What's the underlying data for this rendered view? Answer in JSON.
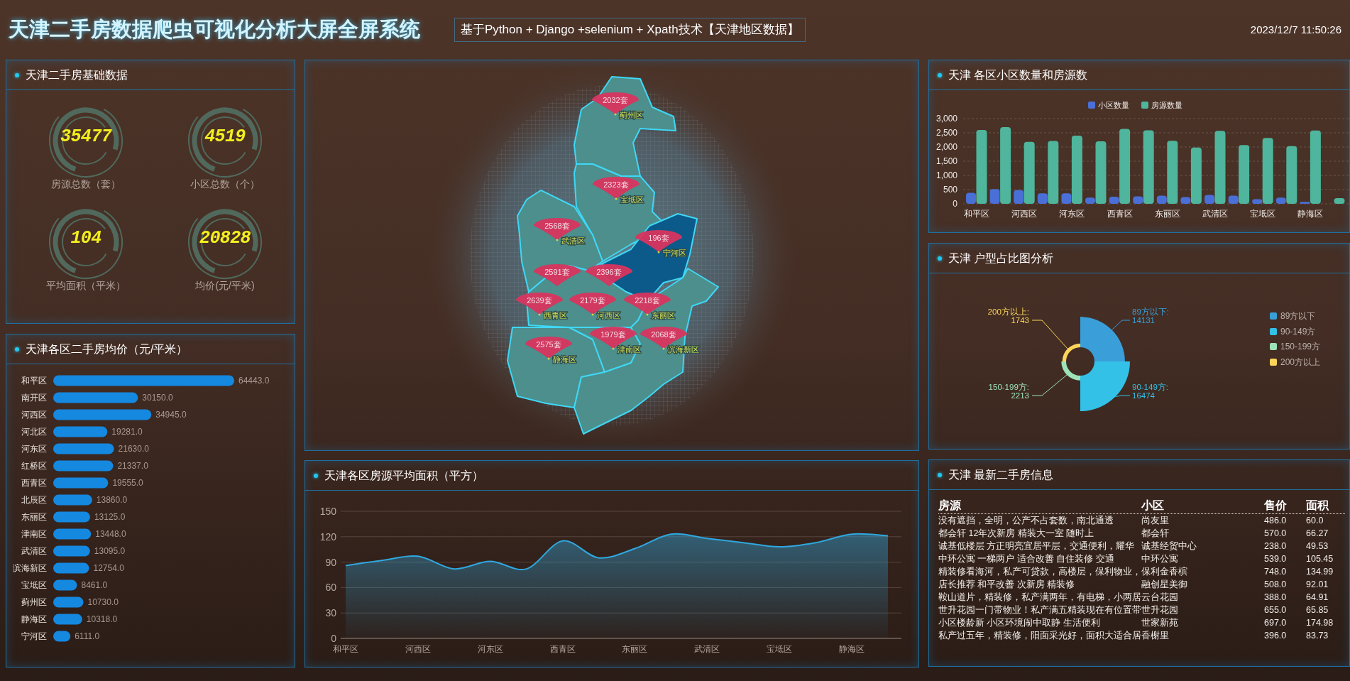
{
  "header": {
    "title": "天津二手房数据爬虫可视化分析大屏全屏系统",
    "subtitle": "基于Python + Django +selenium + Xpath技术【天津地区数据】",
    "datetime": "2023/12/7 11:50:26"
  },
  "overview": {
    "title": "天津二手房基础数据",
    "stats": [
      {
        "value": "35477",
        "label": "房源总数（套）"
      },
      {
        "value": "4519",
        "label": "小区总数（个）"
      },
      {
        "value": "104",
        "label": "平均面积（平米）"
      },
      {
        "value": "20828",
        "label": "均价(元/平米)"
      }
    ]
  },
  "district_price": {
    "title": "天津各区二手房均价（元/平米）",
    "chart_data": {
      "type": "bar",
      "orientation": "horizontal",
      "categories": [
        "和平区",
        "南开区",
        "河西区",
        "河北区",
        "河东区",
        "红桥区",
        "西青区",
        "北辰区",
        "东丽区",
        "津南区",
        "武清区",
        "滨海新区",
        "宝坻区",
        "蓟州区",
        "静海区",
        "宁河区"
      ],
      "values": [
        64443,
        30150,
        34945,
        19281,
        21630,
        21337,
        19555,
        13860,
        13125,
        13448,
        13095,
        12754,
        8461,
        10730,
        10318,
        6111
      ],
      "value_labels": [
        "64443.0",
        "30150.0",
        "34945.0",
        "19281.0",
        "21630.0",
        "21337.0",
        "19555.0",
        "13860.0",
        "13125.0",
        "13448.0",
        "13095.0",
        "12754.0",
        "8461.0",
        "10730.0",
        "10318.0",
        "6111.0"
      ]
    }
  },
  "map": {
    "markers": [
      {
        "count": "2032套",
        "district": "蓟州区",
        "selected": false
      },
      {
        "count": "2323套",
        "district": "宝坻区",
        "selected": false
      },
      {
        "count": "2568套",
        "district": "武清区",
        "selected": false
      },
      {
        "count": "196套",
        "district": "宁河区",
        "selected": true
      },
      {
        "count": "2591套",
        "selected": false
      },
      {
        "count": "2396套",
        "selected": false
      },
      {
        "count": "2639套",
        "district": "西青区",
        "selected": false
      },
      {
        "count": "2179套",
        "district": "河西区",
        "selected": false
      },
      {
        "count": "2218套",
        "district": "东丽区",
        "selected": false
      },
      {
        "count": "1979套",
        "district": "津南区",
        "selected": false
      },
      {
        "count": "2068套",
        "district": "滨海新区",
        "selected": false
      },
      {
        "count": "2575套",
        "district": "静海区",
        "selected": false
      }
    ]
  },
  "area_trend": {
    "title": "天津各区房源平均面积（平方）",
    "chart_data": {
      "type": "area",
      "categories": [
        "和平区",
        null,
        "河西区",
        null,
        "河东区",
        null,
        "西青区",
        null,
        "东丽区",
        null,
        "武清区",
        null,
        "宝坻区",
        null,
        "静海区",
        null
      ],
      "yticks": [
        0,
        30,
        60,
        90,
        120,
        150
      ],
      "ylim": [
        0,
        150
      ],
      "grid": true,
      "series": [
        {
          "color": "#2fa8e0",
          "values": [
            86,
            92,
            97,
            82,
            91,
            82,
            115,
            95,
            106,
            123,
            118,
            113,
            108,
            113,
            123,
            121
          ]
        }
      ]
    }
  },
  "community_counts": {
    "title": "天津 各区小区数量和房源数",
    "chart_data": {
      "type": "bar",
      "categories": [
        "和平区",
        null,
        "河西区",
        null,
        "河东区",
        null,
        "西青区",
        null,
        "东丽区",
        null,
        "武清区",
        null,
        "宝坻区",
        null,
        "静海区",
        null
      ],
      "yticks": [
        {
          "value": 0,
          "label": "0"
        },
        {
          "value": 500,
          "label": "500"
        },
        {
          "value": 1000,
          "label": "1,000"
        },
        {
          "value": 1500,
          "label": "1,500"
        },
        {
          "value": 2000,
          "label": "2,000"
        },
        {
          "value": 2500,
          "label": "2,500"
        },
        {
          "value": 3000,
          "label": "3,000"
        }
      ],
      "ylim": [
        0,
        3000
      ],
      "grid": true,
      "legend": true,
      "series": [
        {
          "name": "小区数量",
          "color": "#4a6fd6",
          "values": [
            390,
            520,
            480,
            370,
            370,
            220,
            250,
            260,
            290,
            240,
            310,
            290,
            160,
            220,
            70,
            0
          ]
        },
        {
          "name": "房源数量",
          "color": "#4fb59c",
          "values": [
            2600,
            2700,
            2180,
            2210,
            2400,
            2200,
            2640,
            2590,
            2220,
            1980,
            2570,
            2070,
            2320,
            2030,
            2580,
            200
          ]
        }
      ]
    }
  },
  "room_types": {
    "title": "天津 户型占比图分析",
    "segments": [
      {
        "legend": "89方以下",
        "label": "89方以下:",
        "value": "14131",
        "color": "#3a9fd8"
      },
      {
        "legend": "90-149方",
        "label": "90-149方:",
        "value": "16474",
        "color": "#33c1e8"
      },
      {
        "legend": "150-199方",
        "label": "150-199方:",
        "value": "2213",
        "color": "#9de3b8"
      },
      {
        "legend": "200方以上",
        "label": "200方以上:",
        "value": "1743",
        "color": "#fdd55a"
      }
    ]
  },
  "latest_listings": {
    "title": "天津 最新二手房信息",
    "columns": [
      "房源",
      "小区",
      "售价",
      "面积"
    ],
    "rows": [
      [
        "没有遮挡，全明，公产不占套数，南北通透",
        "尚友里",
        "486.0",
        "60.0"
      ],
      [
        "都会轩 12年次新房 精装大一室 随时上",
        "都会轩",
        "570.0",
        "66.27"
      ],
      [
        "诚基低楼层 方正明亮宜居平层，交通便利，耀华",
        "诚基经贸中心",
        "238.0",
        "49.53"
      ],
      [
        "中环公寓 一梯两户 适合改善 自住装修 交通",
        "中环公寓",
        "539.0",
        "105.45"
      ],
      [
        "精装修看海河，私产可贷款，高楼层，保利物业，",
        "保利金香槟",
        "748.0",
        "134.99"
      ],
      [
        "店长推荐 和平改善 次新房 精装修",
        "融创星美御",
        "508.0",
        "92.01"
      ],
      [
        "鞍山道片，精装修，私产满两年，有电梯，小两居",
        "云台花园",
        "388.0",
        "64.91"
      ],
      [
        "世升花园一门带物业！私产满五精装现在有位置带",
        "世升花园",
        "655.0",
        "65.85"
      ],
      [
        "小区楼龄新 小区环境闹中取静 生活便利",
        "世家新苑",
        "697.0",
        "174.98"
      ],
      [
        "私产过五年，精装修，阳面采光好，面积大适合居",
        "香榭里",
        "396.0",
        "83.73"
      ]
    ]
  }
}
